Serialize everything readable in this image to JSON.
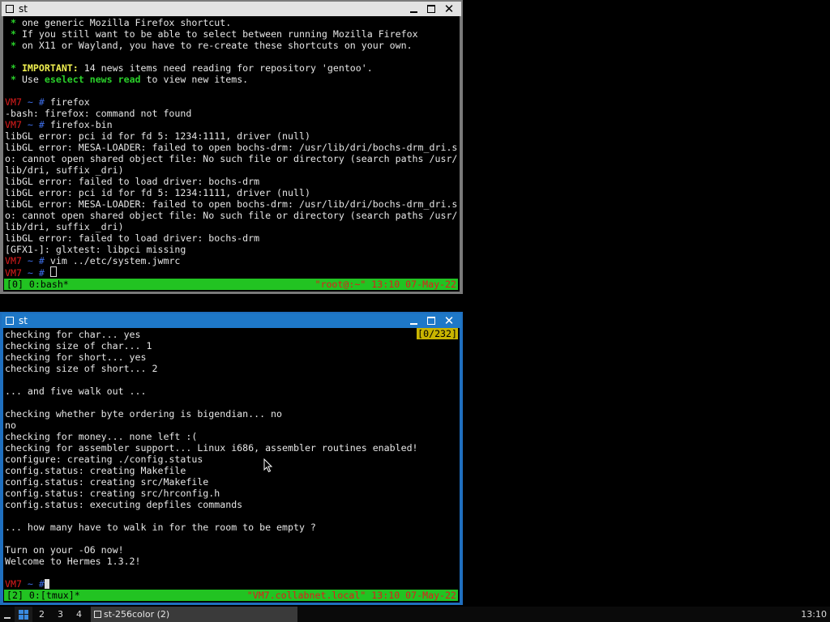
{
  "top_window": {
    "title": "st",
    "lines": [
      [
        [
          "g",
          " * "
        ],
        [
          "",
          "one generic Mozilla Firefox shortcut."
        ]
      ],
      [
        [
          "g",
          " * "
        ],
        [
          "",
          "If you still want to be able to select between running Mozilla Firefox"
        ]
      ],
      [
        [
          "g",
          " * "
        ],
        [
          "",
          "on X11 or Wayland, you have to re-create these shortcuts on your own."
        ]
      ],
      [],
      [
        [
          "g",
          " * "
        ],
        [
          "y",
          "IMPORTANT:"
        ],
        [
          "",
          " 14 news items need reading for repository 'gentoo'."
        ]
      ],
      [
        [
          "g",
          " * "
        ],
        [
          "",
          "Use "
        ],
        [
          "g",
          "eselect news read"
        ],
        [
          "",
          " to view new items."
        ]
      ],
      [],
      [
        [
          "r",
          "VM7"
        ],
        [
          "b",
          " ~ # "
        ],
        [
          "",
          "firefox"
        ]
      ],
      [
        [
          "",
          "-bash: firefox: command not found"
        ]
      ],
      [
        [
          "r",
          "VM7"
        ],
        [
          "b",
          " ~ # "
        ],
        [
          "",
          "firefox-bin"
        ]
      ],
      [
        [
          "",
          "libGL error: pci id for fd 5: 1234:1111, driver (null)"
        ]
      ],
      [
        [
          "",
          "libGL error: MESA-LOADER: failed to open bochs-drm: /usr/lib/dri/bochs-drm_dri.s"
        ]
      ],
      [
        [
          "",
          "o: cannot open shared object file: No such file or directory (search paths /usr/"
        ]
      ],
      [
        [
          "",
          "lib/dri, suffix _dri)"
        ]
      ],
      [
        [
          "",
          "libGL error: failed to load driver: bochs-drm"
        ]
      ],
      [
        [
          "",
          "libGL error: pci id for fd 5: 1234:1111, driver (null)"
        ]
      ],
      [
        [
          "",
          "libGL error: MESA-LOADER: failed to open bochs-drm: /usr/lib/dri/bochs-drm_dri.s"
        ]
      ],
      [
        [
          "",
          "o: cannot open shared object file: No such file or directory (search paths /usr/"
        ]
      ],
      [
        [
          "",
          "lib/dri, suffix _dri)"
        ]
      ],
      [
        [
          "",
          "libGL error: failed to load driver: bochs-drm"
        ]
      ],
      [
        [
          "",
          "[GFX1-]: glxtest: libpci missing"
        ]
      ],
      [
        [
          "r",
          "VM7"
        ],
        [
          "b",
          " ~ # "
        ],
        [
          "",
          "vim ../etc/system.jwmrc"
        ]
      ],
      [
        [
          "r",
          "VM7"
        ],
        [
          "b",
          " ~ # "
        ],
        [
          "cursor-box",
          ""
        ]
      ]
    ],
    "status_left": "[0] 0:bash*",
    "status_right": "\"root@:~\" 13:10 07-May-22"
  },
  "bottom_window": {
    "title": "st",
    "scroll_position": "[0/232]",
    "lines": [
      [
        [
          "",
          "checking for char... yes"
        ]
      ],
      [
        [
          "",
          "checking size of char... 1"
        ]
      ],
      [
        [
          "",
          "checking for short... yes"
        ]
      ],
      [
        [
          "",
          "checking size of short... 2"
        ]
      ],
      [],
      [
        [
          "",
          "... and five walk out ..."
        ]
      ],
      [],
      [
        [
          "",
          "checking whether byte ordering is bigendian... no"
        ]
      ],
      [
        [
          "",
          "no"
        ]
      ],
      [
        [
          "",
          "checking for money... none left :("
        ]
      ],
      [
        [
          "",
          "checking for assembler support... Linux i686, assembler routines enabled!"
        ]
      ],
      [
        [
          "",
          "configure: creating ./config.status"
        ]
      ],
      [
        [
          "",
          "config.status: creating Makefile"
        ]
      ],
      [
        [
          "",
          "config.status: creating src/Makefile"
        ]
      ],
      [
        [
          "",
          "config.status: creating src/hrconfig.h"
        ]
      ],
      [
        [
          "",
          "config.status: executing depfiles commands"
        ]
      ],
      [],
      [
        [
          "",
          "... how many have to walk in for the room to be empty ?"
        ]
      ],
      [],
      [
        [
          "",
          "Turn on your -O6 now!"
        ]
      ],
      [
        [
          "",
          "Welcome to Hermes 1.3.2!"
        ]
      ],
      [],
      [
        [
          "r",
          "VM7"
        ],
        [
          "b",
          " ~ #"
        ],
        [
          "cursor-solid",
          ""
        ]
      ]
    ],
    "status_left": "[2] 0:[tmux]*",
    "status_right": "\"VM7.collabnet.local\" 13:10 07-May-22"
  },
  "taskbar": {
    "workspaces": [
      "2",
      "3",
      "4"
    ],
    "task_label": "st-256color (2)",
    "clock": "13:10"
  }
}
